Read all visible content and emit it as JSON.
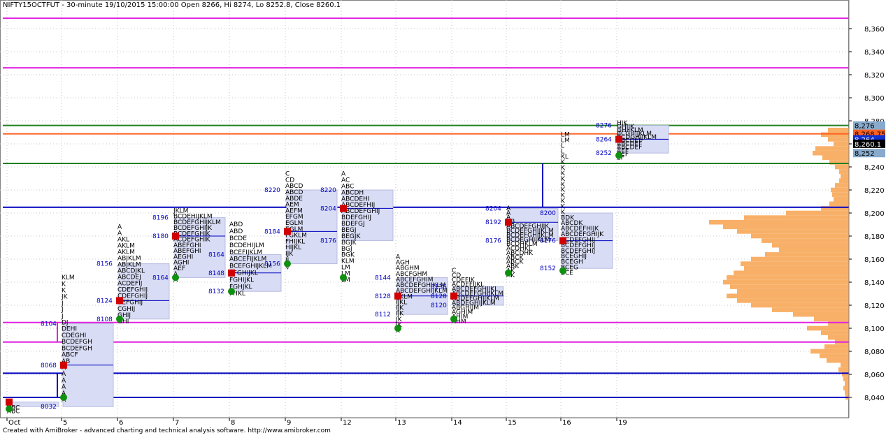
{
  "header": {
    "title": "NIFTY15OCTFUT - 30-minute 19/10/2015 15:00:00 Open 8266, Hi 8274, Lo 8252.8, Close 8260.1"
  },
  "footer": {
    "text": "Created with AmiBroker - advanced charting and technical analysis software. http://www.amibroker.com"
  },
  "colors": {
    "background": "#ffffff",
    "grid": "#b0b0b0",
    "axis_panel": "#ffffff",
    "magenta": "#e020e0",
    "green": "#208020",
    "orange_line": "#ff6020",
    "blue_line": "#0000c0",
    "value_area": "#d8dcf4",
    "volume_profile": "#f8b068",
    "letters": "#000000",
    "price_label": "#0000c0",
    "red_marker": "#d00000",
    "green_marker": "#109010"
  },
  "chart_data": {
    "type": "market_profile",
    "ylim": [
      8030,
      8370
    ],
    "y_ticks": [
      8040,
      8060,
      8080,
      8100,
      8120,
      8140,
      8160,
      8180,
      8200,
      8220,
      8240,
      8260,
      8280,
      8300,
      8320,
      8340,
      8360
    ],
    "y_tick_labels": [
      "8,040",
      "8,060",
      "8,080",
      "8,100",
      "8,120",
      "8,140",
      "8,160",
      "8,180",
      "8,200",
      "8,220",
      "8,240",
      "8,260",
      "8,280",
      "8,300",
      "8,320",
      "8,340",
      "8,360"
    ],
    "x_tick_labels": [
      "Oct",
      "5",
      "6",
      "7",
      "8",
      "9",
      "12",
      "13",
      "14",
      "15",
      "16",
      "19"
    ],
    "price_badges": [
      {
        "text": "8,276",
        "value": 8276,
        "bg": "#88aacc",
        "fg": "#000000"
      },
      {
        "text": "8,268.75",
        "value": 8268.75,
        "bg": "#ff6020",
        "fg": "#000000"
      },
      {
        "text": "8,264",
        "value": 8264,
        "bg": "#1030d0",
        "fg": "#ffffff"
      },
      {
        "text": "8,260.1",
        "value": 8260.1,
        "bg": "#000000",
        "fg": "#ffffff"
      },
      {
        "text": "8,252",
        "value": 8252,
        "bg": "#88aacc",
        "fg": "#000000"
      }
    ],
    "horizontal_lines": [
      {
        "value": 8369,
        "color": "#e020e0"
      },
      {
        "value": 8326,
        "color": "#e020e0"
      },
      {
        "value": 8276,
        "color": "#208020"
      },
      {
        "value": 8268.75,
        "color": "#ff6020"
      },
      {
        "value": 8243,
        "color": "#208020"
      },
      {
        "value": 8205,
        "color": "#0000c0"
      },
      {
        "value": 8105,
        "color": "#e020e0"
      },
      {
        "value": 8088,
        "color": "#e020e0"
      },
      {
        "value": 8061,
        "color": "#0000c0"
      },
      {
        "value": 8040,
        "color": "#0000c0"
      }
    ],
    "profiles": [
      {
        "day": "Oct",
        "val": 8032,
        "vah": 8036,
        "poc": null,
        "low": 8030,
        "high": 8036,
        "letters": [
          "A",
          "ABC",
          "ABC"
        ],
        "labels": []
      },
      {
        "day": "5",
        "val": 8032,
        "vah": 8104,
        "poc": 8068,
        "low": 8040,
        "high": 8146,
        "letters": [
          "KLM",
          "K",
          "K",
          "JK",
          "J",
          "J",
          "J",
          "DJ",
          "DEHI",
          "CDEGHI",
          "BCDEFGH",
          "BCDEFGH",
          "ABCF",
          "AB",
          "A",
          "A",
          "A",
          "A",
          "A",
          "A"
        ],
        "labels": [
          "8104",
          "8068",
          "8032"
        ]
      },
      {
        "day": "6",
        "val": 8108,
        "vah": 8156,
        "poc": 8124,
        "low": 8108,
        "high": 8190,
        "letters": [
          "A",
          "A",
          "AKL",
          "AKLM",
          "AKLM",
          "ABJKLM",
          "ABJKLM",
          "ABCDJKL",
          "ABCDEJ",
          "ACDEFIJ",
          "CDEFGHIJ",
          "CDEFGHIJ",
          "CEFGHIJ",
          "CGHIJ",
          "GHIJ",
          "GHI"
        ],
        "labels": [
          "8156",
          "8124",
          "8108"
        ]
      },
      {
        "day": "7",
        "val": 8144,
        "vah": 8196,
        "poc": 8180,
        "low": 8144,
        "high": 8204,
        "letters": [
          "JKLM",
          "BCDEHIJKLM",
          "BCDEFGHIJKLM",
          "BCDEFGHIJK",
          "BCDEFGHIK",
          "ACDEFGHIK",
          "ABEFGHI",
          "ABEFGHI",
          "AEGHI",
          "AGHI",
          "AEF",
          "A",
          "A"
        ],
        "labels": [
          "8196",
          "8180",
          "8164"
        ]
      },
      {
        "day": "8",
        "val": 8132,
        "vah": 8164,
        "poc": 8148,
        "low": 8132,
        "high": 8192,
        "letters": [
          "ABD",
          "ABD",
          "BCDE",
          "BCDEHIJLM",
          "BCEFIJKLM",
          "ABCEFIJKLM",
          "BCEFGHIJKLM",
          "EFGHIJKL",
          "FGHIJKL",
          "FGHJKL",
          "FHKL"
        ],
        "labels": [
          "8164",
          "8148",
          "8132"
        ]
      },
      {
        "day": "9",
        "val": 8156,
        "vah": 8220,
        "poc": 8184,
        "low": 8156,
        "high": 8236,
        "letters": [
          "C",
          "CD",
          "ABCD",
          "ABCD",
          "ABDE",
          "AEM",
          "AEFM",
          "EFGM",
          "EGLM",
          "EGLM",
          "FGKLM",
          "FHIJKL",
          "HIJKL",
          "IJK",
          "IJ",
          "IJ"
        ],
        "labels": [
          "8220",
          "8184",
          "8156"
        ]
      },
      {
        "day": "12",
        "val": 8176,
        "vah": 8220,
        "poc": 8204,
        "low": 8144,
        "high": 8236,
        "letters": [
          "A",
          "AC",
          "ABC",
          "ABCDH",
          "ABCDEHI",
          "ABCDEFHIJ",
          "ABCDEFGHIJ",
          "BDEFGHIJ",
          "BDEFGJ",
          "BEGJ",
          "BEGJK",
          "BGJK",
          "BGJ",
          "BGK",
          "KLM",
          "LM",
          "LM",
          "LM"
        ],
        "labels": [
          "8220",
          "8204",
          "8176"
        ]
      },
      {
        "day": "13",
        "val": 8112,
        "vah": 8144,
        "poc": 8128,
        "low": 8100,
        "high": 8164,
        "letters": [
          "A",
          "AGH",
          "ABGHM",
          "ABCFGHM",
          "ABCEFGHIM",
          "ABCDEFGHIKLM",
          "ABCDEFGHIJKLM",
          "IJKLM",
          "IJKL",
          "IJK",
          "IJK",
          "JK",
          "JK",
          "K"
        ],
        "labels": [
          "8144",
          "8128",
          "8112"
        ]
      },
      {
        "day": "14",
        "val": 8120,
        "vah": 8136,
        "poc": 8128,
        "low": 8108,
        "high": 8152,
        "letters": [
          "C",
          "CD",
          "CDEFIK",
          "ACDEFIJKL",
          "ABCDEFGHIJKL",
          "ABCDEFGHIJKLM",
          "ABDEFGHIJKLM",
          "ABDEGHIJKLM",
          "ABGHIJM",
          "AGHIM",
          "AHIM",
          "AHM"
        ],
        "labels": [
          "8136",
          "8128",
          "8120"
        ]
      },
      {
        "day": "15",
        "val": 8176,
        "vah": 8204,
        "poc": 8192,
        "low": 8148,
        "high": 8206,
        "letters": [
          "A",
          "A",
          "A",
          "AB",
          "ABCDEFGHIJK",
          "BCDEFGHIJKLM",
          "BCDEFGHIJKLM",
          "BCDEGHIJKLM",
          "BCDHKLM",
          "ACDHKL",
          "ABCDHK",
          "ABCK",
          "ABCK",
          "ABK",
          "AK",
          "AK"
        ],
        "labels": [
          "8204",
          "8192",
          "8176"
        ]
      },
      {
        "day": "16",
        "val": 8152,
        "vah": 8200,
        "poc": 8176,
        "low": 8150,
        "high": 8270,
        "letters": [
          "LM",
          "LM",
          "L",
          "L",
          "KL",
          "K",
          "K",
          "K",
          "K",
          "K",
          "K",
          "K",
          "K",
          "K",
          "K",
          "BDK",
          "ABCDK",
          "ABCDEFHIJK",
          "ABCDEFGHIJK",
          "BCDEFGHIJ",
          "BCDEFGHIJ",
          "BCDEFGHIJ",
          "BCEGHIJ",
          "BCEGH",
          "BCEG",
          "BCE"
        ],
        "labels": [
          "8200",
          "8176",
          "8152"
        ]
      },
      {
        "day": "19",
        "val": 8252,
        "vah": 8276,
        "poc": 8264,
        "low": 8250,
        "high": 8280,
        "letters": [
          "HIK",
          "GHIJK",
          "GHIJKLM",
          "BCGHIJKLM",
          "BCDGHIJKLM",
          "ABCDEF",
          "ABCDEF",
          "ABCDEF",
          "AEF",
          "AEF",
          "EF"
        ],
        "labels": [
          "8276",
          "8264",
          "8252"
        ]
      }
    ],
    "volume_profile": [
      {
        "price": 8272,
        "size": 30
      },
      {
        "price": 8268,
        "size": 40
      },
      {
        "price": 8264,
        "size": 30
      },
      {
        "price": 8260,
        "size": 22
      },
      {
        "price": 8256,
        "size": 48
      },
      {
        "price": 8252,
        "size": 52
      },
      {
        "price": 8248,
        "size": 38
      },
      {
        "price": 8244,
        "size": 28
      },
      {
        "price": 8240,
        "size": 20
      },
      {
        "price": 8236,
        "size": 14
      },
      {
        "price": 8232,
        "size": 12
      },
      {
        "price": 8228,
        "size": 14
      },
      {
        "price": 8224,
        "size": 20
      },
      {
        "price": 8220,
        "size": 26
      },
      {
        "price": 8216,
        "size": 24
      },
      {
        "price": 8212,
        "size": 22
      },
      {
        "price": 8208,
        "size": 28
      },
      {
        "price": 8204,
        "size": 40
      },
      {
        "price": 8200,
        "size": 90
      },
      {
        "price": 8196,
        "size": 150
      },
      {
        "price": 8192,
        "size": 200
      },
      {
        "price": 8188,
        "size": 180
      },
      {
        "price": 8184,
        "size": 160
      },
      {
        "price": 8180,
        "size": 140
      },
      {
        "price": 8176,
        "size": 125
      },
      {
        "price": 8172,
        "size": 110
      },
      {
        "price": 8168,
        "size": 100
      },
      {
        "price": 8164,
        "size": 120
      },
      {
        "price": 8160,
        "size": 140
      },
      {
        "price": 8156,
        "size": 155
      },
      {
        "price": 8152,
        "size": 150
      },
      {
        "price": 8148,
        "size": 165
      },
      {
        "price": 8144,
        "size": 175
      },
      {
        "price": 8140,
        "size": 180
      },
      {
        "price": 8136,
        "size": 170
      },
      {
        "price": 8132,
        "size": 160
      },
      {
        "price": 8128,
        "size": 175
      },
      {
        "price": 8124,
        "size": 160
      },
      {
        "price": 8120,
        "size": 140
      },
      {
        "price": 8116,
        "size": 110
      },
      {
        "price": 8112,
        "size": 80
      },
      {
        "price": 8108,
        "size": 50
      },
      {
        "price": 8104,
        "size": 30
      },
      {
        "price": 8100,
        "size": 60
      },
      {
        "price": 8096,
        "size": 40
      },
      {
        "price": 8092,
        "size": 30
      },
      {
        "price": 8088,
        "size": 20
      },
      {
        "price": 8084,
        "size": 35
      },
      {
        "price": 8080,
        "size": 55
      },
      {
        "price": 8076,
        "size": 42
      },
      {
        "price": 8072,
        "size": 32
      },
      {
        "price": 8068,
        "size": 12
      },
      {
        "price": 8064,
        "size": 15
      },
      {
        "price": 8060,
        "size": 10
      },
      {
        "price": 8056,
        "size": 8
      },
      {
        "price": 8052,
        "size": 6
      },
      {
        "price": 8048,
        "size": 8
      },
      {
        "price": 8044,
        "size": 6
      },
      {
        "price": 8040,
        "size": 5
      }
    ]
  }
}
